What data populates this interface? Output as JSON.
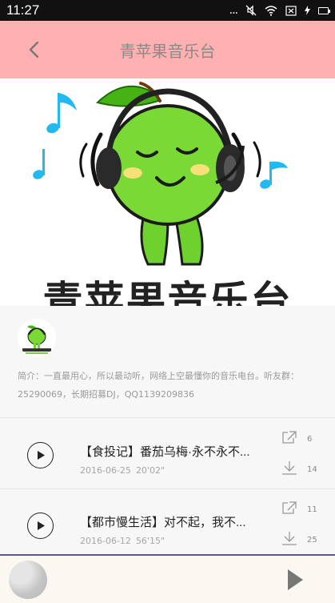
{
  "status": {
    "time": "11:27",
    "signal": "...",
    "icons": [
      "signal-dots-icon",
      "mute-icon",
      "wifi-icon",
      "sim-icon",
      "battery-icon"
    ]
  },
  "header": {
    "title": "青苹果音乐台"
  },
  "banner": {
    "logo_text": "青苹果音乐台"
  },
  "info": {
    "description": "简介：一直最用心，所以最动听，网络上空最懂你的音乐电台。听友群：25290069，长期招募DJ，QQ1139209836"
  },
  "tracks": [
    {
      "title": "【食投记】番茄乌梅·永不永不...",
      "date": "2016-06-25",
      "duration": "20'02\"",
      "shares": "6",
      "downloads": "14"
    },
    {
      "title": "【都市慢生活】对不起，我不...",
      "date": "2016-06-12",
      "duration": "56'15\"",
      "shares": "11",
      "downloads": "25"
    }
  ],
  "colors": {
    "header_bg": "#ffb0b0",
    "player_border": "#5a5a86"
  }
}
